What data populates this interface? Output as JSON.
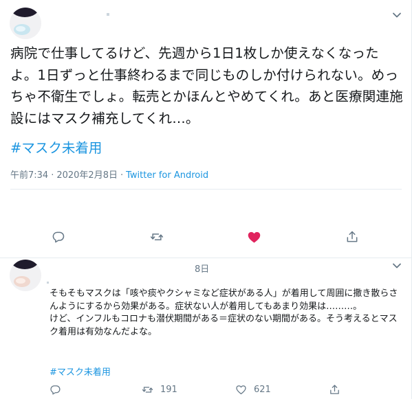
{
  "tweet_main": {
    "text": "病院で仕事してるけど、先週から1日1枚しか使えなくなったよ。1日ずっと仕事終わるまで同じものしか付けられない。めっちゃ不衛生でしょ。転売とかほんとやめてくれ。あと医療関連施設にはマスク補充してくれ…。",
    "hashtag": "#マスク未着用",
    "time": "午前7:34",
    "separator": "·",
    "date": "2020年2月8日",
    "source": "Twitter for Android",
    "liked": true,
    "colors": {
      "like": "#e0245e",
      "link": "#1b95e0",
      "muted": "#657786"
    }
  },
  "tweet_reply": {
    "date_fragment": "8日",
    "text": "そもそもマスクは「咳や痰やクシャミなど症状がある人」が着用して周囲に撒き散らさんようにするから効果がある。症状ない人が着用してもあまり効果は………。\nけど、インフルもコロナも潜伏期間がある＝症状のない期間がある。そう考えるとマスク着用は有効なんだよな。",
    "hashtag": "#マスク未着用",
    "retweet_count": "191",
    "like_count": "621"
  }
}
